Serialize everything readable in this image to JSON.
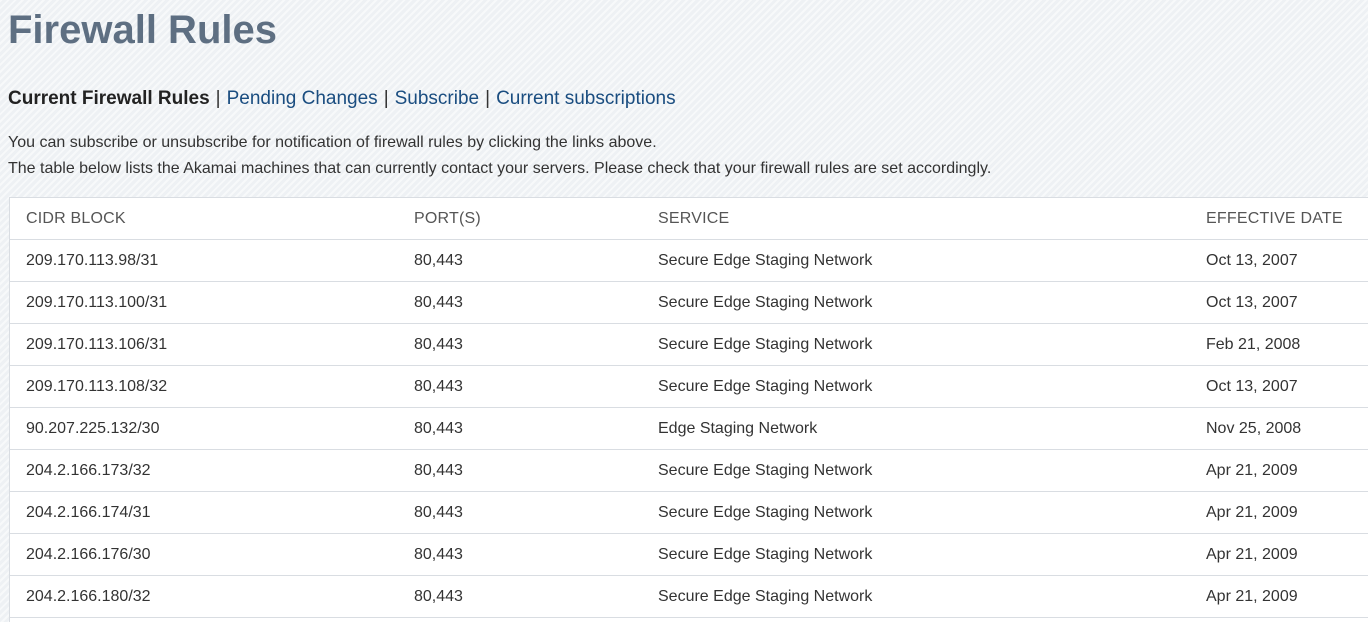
{
  "page": {
    "title": "Firewall Rules"
  },
  "subnav": {
    "current": "Current Firewall Rules",
    "separator": "|",
    "links": [
      {
        "label": "Pending Changes"
      },
      {
        "label": "Subscribe"
      },
      {
        "label": "Current subscriptions"
      }
    ]
  },
  "intro": {
    "line1": "You can subscribe or unsubscribe for notification of firewall rules by clicking the links above.",
    "line2": "The table below lists the Akamai machines that can currently contact your servers. Please check that your firewall rules are set accordingly."
  },
  "table": {
    "headers": [
      "CIDR BLOCK",
      "PORT(S)",
      "SERVICE",
      "EFFECTIVE DATE"
    ],
    "rows": [
      {
        "cidr": "209.170.113.98/31",
        "ports": "80,443",
        "service": "Secure Edge Staging Network",
        "date": "Oct 13, 2007"
      },
      {
        "cidr": "209.170.113.100/31",
        "ports": "80,443",
        "service": "Secure Edge Staging Network",
        "date": "Oct 13, 2007"
      },
      {
        "cidr": "209.170.113.106/31",
        "ports": "80,443",
        "service": "Secure Edge Staging Network",
        "date": "Feb 21, 2008"
      },
      {
        "cidr": "209.170.113.108/32",
        "ports": "80,443",
        "service": "Secure Edge Staging Network",
        "date": "Oct 13, 2007"
      },
      {
        "cidr": "90.207.225.132/30",
        "ports": "80,443",
        "service": "Edge Staging Network",
        "date": "Nov 25, 2008"
      },
      {
        "cidr": "204.2.166.173/32",
        "ports": "80,443",
        "service": "Secure Edge Staging Network",
        "date": "Apr 21, 2009"
      },
      {
        "cidr": "204.2.166.174/31",
        "ports": "80,443",
        "service": "Secure Edge Staging Network",
        "date": "Apr 21, 2009"
      },
      {
        "cidr": "204.2.166.176/30",
        "ports": "80,443",
        "service": "Secure Edge Staging Network",
        "date": "Apr 21, 2009"
      },
      {
        "cidr": "204.2.166.180/32",
        "ports": "80,443",
        "service": "Secure Edge Staging Network",
        "date": "Apr 21, 2009"
      }
    ]
  },
  "colors": {
    "title": "#5e6f82",
    "link": "#1a4d80",
    "text": "#333333",
    "page_background": "#eef1f4",
    "table_background": "#ffffff",
    "border": "#d9dde2"
  }
}
